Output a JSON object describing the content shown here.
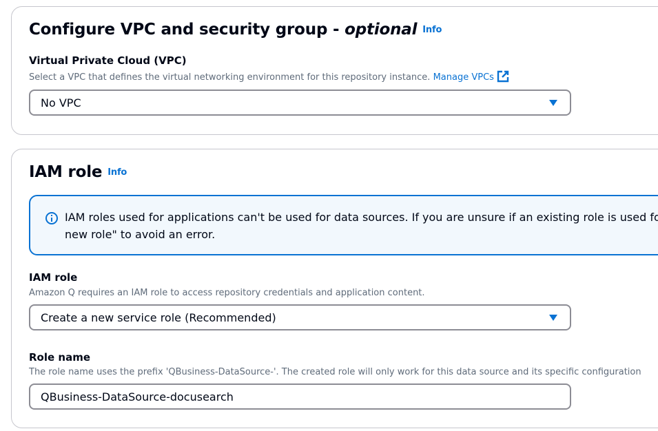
{
  "vpc_section": {
    "title": "Configure VPC and security group - ",
    "title_optional": "optional",
    "info_label": "Info",
    "vpc_field": {
      "label": "Virtual Private Cloud (VPC)",
      "description": "Select a VPC that defines the virtual networking environment for this repository instance.",
      "link_label": "Manage VPCs",
      "selected_value": "No VPC"
    }
  },
  "iam_section": {
    "title": "IAM role",
    "info_label": "Info",
    "alert_text": "IAM roles used for applications can't be used for data sources. If you are unsure if an existing role is used for a new role\" to avoid an error.",
    "iam_role_field": {
      "label": "IAM role",
      "description": "Amazon Q requires an IAM role to access repository credentials and application content.",
      "selected_value": "Create a new service role (Recommended)"
    },
    "role_name_field": {
      "label": "Role name",
      "description": "The role name uses the prefix 'QBusiness-DataSource-'. The created role will only work for this data source and its specific configuration",
      "value": "QBusiness-DataSource-docusearch"
    }
  },
  "colors": {
    "link": "#0972d3",
    "border": "#c6c6cd",
    "alert_bg": "#f2f8fd"
  }
}
